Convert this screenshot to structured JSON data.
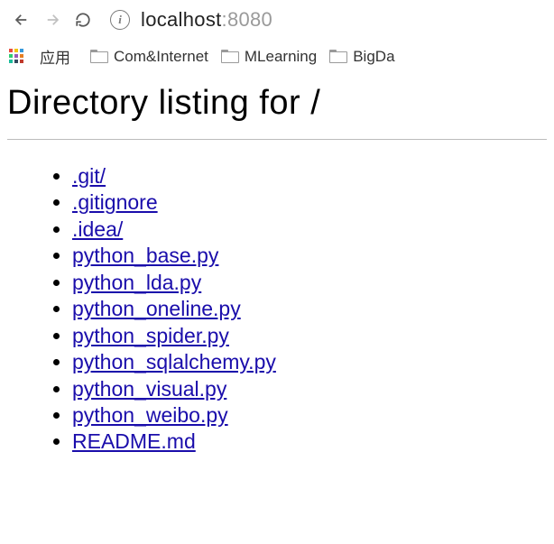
{
  "toolbar": {
    "host": "localhost",
    "port": ":8080"
  },
  "bookmarks": {
    "apps_label": "应用",
    "items": [
      "Com&Internet",
      "MLearning",
      "BigDa"
    ]
  },
  "page": {
    "heading": "Directory listing for /"
  },
  "files": [
    ".git/",
    ".gitignore",
    ".idea/",
    "python_base.py",
    "python_lda.py",
    "python_oneline.py",
    "python_spider.py",
    "python_sqlalchemy.py",
    "python_visual.py",
    "python_weibo.py",
    "README.md"
  ]
}
